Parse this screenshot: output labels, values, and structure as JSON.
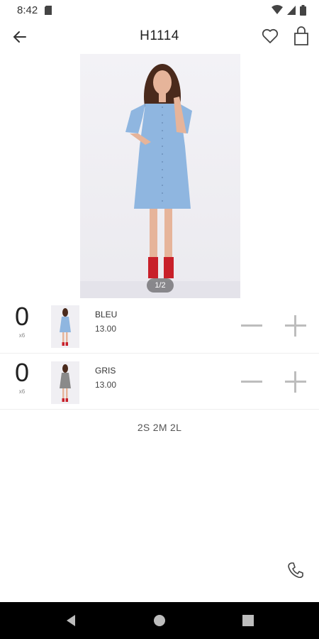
{
  "status_bar": {
    "time": "8:42"
  },
  "toolbar": {
    "title": "H1114"
  },
  "gallery": {
    "pager": "1/2"
  },
  "variants": [
    {
      "quantity": "0",
      "unit": "x6",
      "name": "BLEU",
      "price": "13.00",
      "thumb_color": "#8fb6e0"
    },
    {
      "quantity": "0",
      "unit": "x6",
      "name": "GRIS",
      "price": "13.00",
      "thumb_color": "#8a8a8a"
    }
  ],
  "sizes": "2S 2M 2L",
  "colors": {
    "dress_main": "#8fb6e0",
    "shoes": "#c8202a",
    "divider": "#eeeeee",
    "control_gray": "#bdbdbd"
  }
}
